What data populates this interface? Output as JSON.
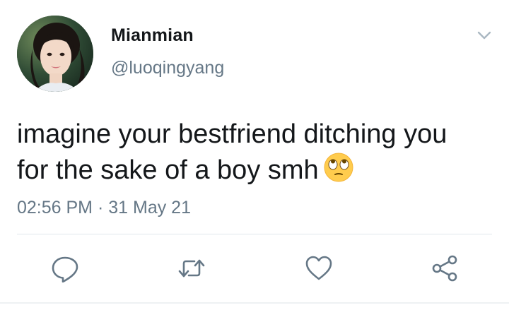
{
  "tweet": {
    "display_name": "Mianmian",
    "handle": "@luoqingyang",
    "text_line1": "imagine your bestfriend ditching you",
    "text_line2": "for the sake of a boy smh",
    "emoji": "face-with-rolling-eyes",
    "time": "02:56 PM",
    "separator": "·",
    "date": "31 May 21"
  },
  "actions": [
    "reply-icon",
    "retweet-icon",
    "like-icon",
    "share-icon"
  ],
  "colors": {
    "primary_text": "#14171a",
    "secondary_text": "#657786",
    "divider": "#e1e8ed",
    "icon": "#657786"
  }
}
